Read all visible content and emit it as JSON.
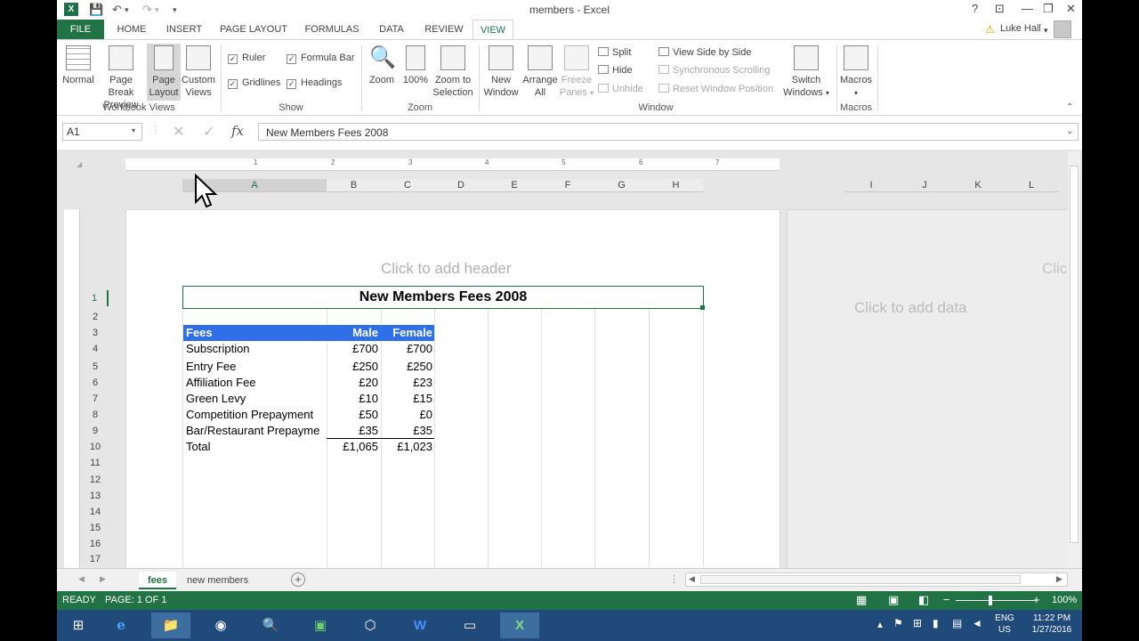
{
  "window": {
    "title": "members - Excel",
    "user": "Luke Hall",
    "help": "?",
    "minimize": "—",
    "restore": "❐",
    "close": "✕"
  },
  "tabs": {
    "file": "FILE",
    "items": [
      "HOME",
      "INSERT",
      "PAGE LAYOUT",
      "FORMULAS",
      "DATA",
      "REVIEW",
      "VIEW"
    ],
    "active": "VIEW"
  },
  "ribbon": {
    "workbook_views": {
      "label": "Workbook Views",
      "normal": "Normal",
      "page_break_1": "Page Break",
      "page_break_2": "Preview",
      "page_layout_1": "Page",
      "page_layout_2": "Layout",
      "custom_1": "Custom",
      "custom_2": "Views"
    },
    "show": {
      "label": "Show",
      "ruler": "Ruler",
      "formula_bar": "Formula Bar",
      "gridlines": "Gridlines",
      "headings": "Headings"
    },
    "zoom": {
      "label": "Zoom",
      "zoom": "Zoom",
      "hundred": "100%",
      "zoom_sel_1": "Zoom to",
      "zoom_sel_2": "Selection"
    },
    "window": {
      "label": "Window",
      "new_1": "New",
      "new_2": "Window",
      "arrange_1": "Arrange",
      "arrange_2": "All",
      "freeze_1": "Freeze",
      "freeze_2": "Panes",
      "split": "Split",
      "hide": "Hide",
      "unhide": "Unhide",
      "side_by_side": "View Side by Side",
      "sync_scroll": "Synchronous Scrolling",
      "reset_pos": "Reset Window Position",
      "switch_1": "Switch",
      "switch_2": "Windows"
    },
    "macros": {
      "label": "Macros",
      "macros": "Macros"
    }
  },
  "formula_bar": {
    "name_box": "A1",
    "fx": "fx",
    "value": "New Members Fees 2008"
  },
  "sheet": {
    "columns_left": [
      "A",
      "B",
      "C",
      "D",
      "E",
      "F",
      "G",
      "H"
    ],
    "columns_right": [
      "I",
      "J",
      "K",
      "L"
    ],
    "ruler_numbers": [
      "1",
      "2",
      "3",
      "4",
      "5",
      "6",
      "7"
    ],
    "header_hint": "Click to add header",
    "header_hint_right": "Clic",
    "data_hint": "Click to add data",
    "rows": [
      "1",
      "2",
      "3",
      "4",
      "5",
      "6",
      "7",
      "8",
      "9",
      "10",
      "11",
      "12",
      "13",
      "14",
      "15",
      "16",
      "17"
    ],
    "title": "New Members Fees 2008",
    "table_header": [
      "Fees",
      "Male",
      "Female"
    ],
    "table_rows": [
      [
        "Subscription",
        "£700",
        "£700"
      ],
      [
        "Entry Fee",
        "£250",
        "£250"
      ],
      [
        "Affiliation Fee",
        "£20",
        "£23"
      ],
      [
        "Green Levy",
        "£10",
        "£15"
      ],
      [
        "Competition Prepayment",
        "£50",
        "£0"
      ],
      [
        "Bar/Restaurant Prepayme",
        "£35",
        "£35"
      ],
      [
        "Total",
        "£1,065",
        "£1,023"
      ]
    ],
    "header_fill": "#2f6fe8"
  },
  "sheet_tabs": [
    "fees",
    "new members"
  ],
  "status": {
    "ready": "READY",
    "page": "PAGE: 1 OF 1",
    "zoom": "100%"
  },
  "taskbar": {
    "lang_1": "ENG",
    "lang_2": "US",
    "time": "11:22 PM",
    "date": "1/27/2016"
  }
}
